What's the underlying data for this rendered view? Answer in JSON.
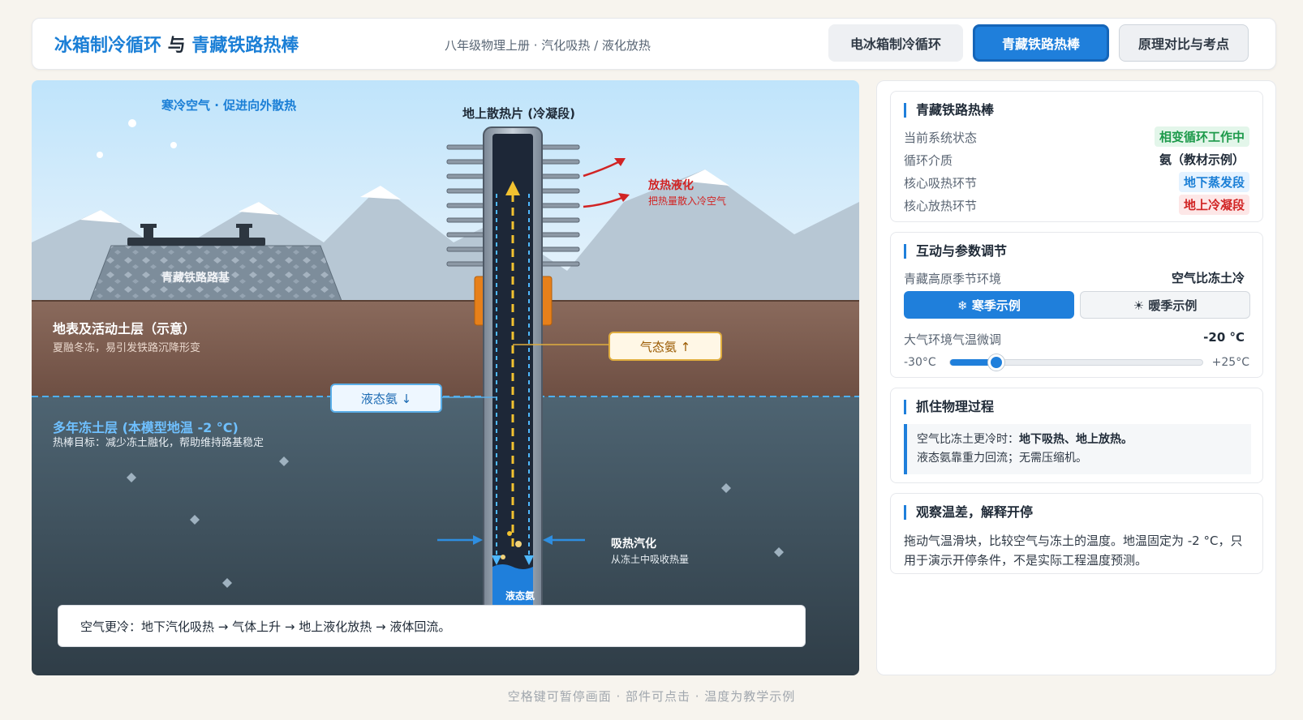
{
  "header": {
    "title_part1": "冰箱制冷循环",
    "title_sep": " 与 ",
    "title_part2": "青藏铁路热棒",
    "subtitle": "八年级物理上册 · 汽化吸热 / 液化放热",
    "tabs": [
      {
        "label": "电冰箱制冷循环",
        "active": false
      },
      {
        "label": "青藏铁路热棒",
        "active": true
      },
      {
        "label": "原理对比与考点",
        "active": false
      }
    ]
  },
  "scene": {
    "sky_label": "寒冷空气 · 促进向外散热",
    "fin_label": "地上散热片 (冷凝段)",
    "release_title": "放热液化",
    "release_sub": "把热量散入冷空气",
    "roadbed_label": "青藏铁路路基",
    "soil_title": "地表及活动土层（示意）",
    "soil_sub": "夏融冬冻，易引发铁路沉降形变",
    "permafrost_title": "多年冻土层 (本模型地温 -2 °C)",
    "permafrost_sub": "热棒目标：减少冻土融化，帮助维持路基稳定",
    "gas_callout": "气态氨 ↑",
    "liquid_callout": "液态氨 ↓",
    "absorb_title": "吸热汽化",
    "absorb_sub": "从冻土中吸收热量",
    "liquid_pool_label": "液态氨",
    "caption": "空气更冷：地下汽化吸热 → 气体上升 → 地上液化放热 → 液体回流。"
  },
  "status_card": {
    "title": "青藏铁路热棒",
    "rows": [
      {
        "key": "当前系统状态",
        "value": "相变循环工作中",
        "tone": "green"
      },
      {
        "key": "循环介质",
        "value": "氨（教材示例）",
        "tone": "plain"
      },
      {
        "key": "核心吸热环节",
        "value": "地下蒸发段",
        "tone": "blue"
      },
      {
        "key": "核心放热环节",
        "value": "地上冷凝段",
        "tone": "red"
      }
    ]
  },
  "controls_card": {
    "title": "互动与参数调节",
    "season_label": "青藏高原季节环境",
    "season_value": "空气比冻土冷",
    "cold_button": "❄ 寒季示例",
    "warm_button": "☀ 暖季示例",
    "temp_label": "大气环境气温微调",
    "temp_value": "-20 °C",
    "slider_min": "-30°C",
    "slider_max": "+25°C",
    "slider_min_value": -30,
    "slider_max_value": 25,
    "slider_current": -20
  },
  "physics_card": {
    "title": "抓住物理过程",
    "line1_prefix": "空气比冻土更冷时：",
    "line1_bold": "地下吸热、地上放热。",
    "line2": "液态氨靠重力回流；无需压缩机。"
  },
  "observe_card": {
    "title": "观察温差，解释开停",
    "text": "拖动气温滑块，比较空气与冻土的温度。地温固定为 -2 °C，只用于演示开停条件，不是实际工程温度预测。"
  },
  "footer": "空格键可暂停画面 · 部件可点击 · 温度为教学示例",
  "colors": {
    "accent": "#1f7fdb",
    "green": "#1d9a4b",
    "red": "#d12424"
  }
}
